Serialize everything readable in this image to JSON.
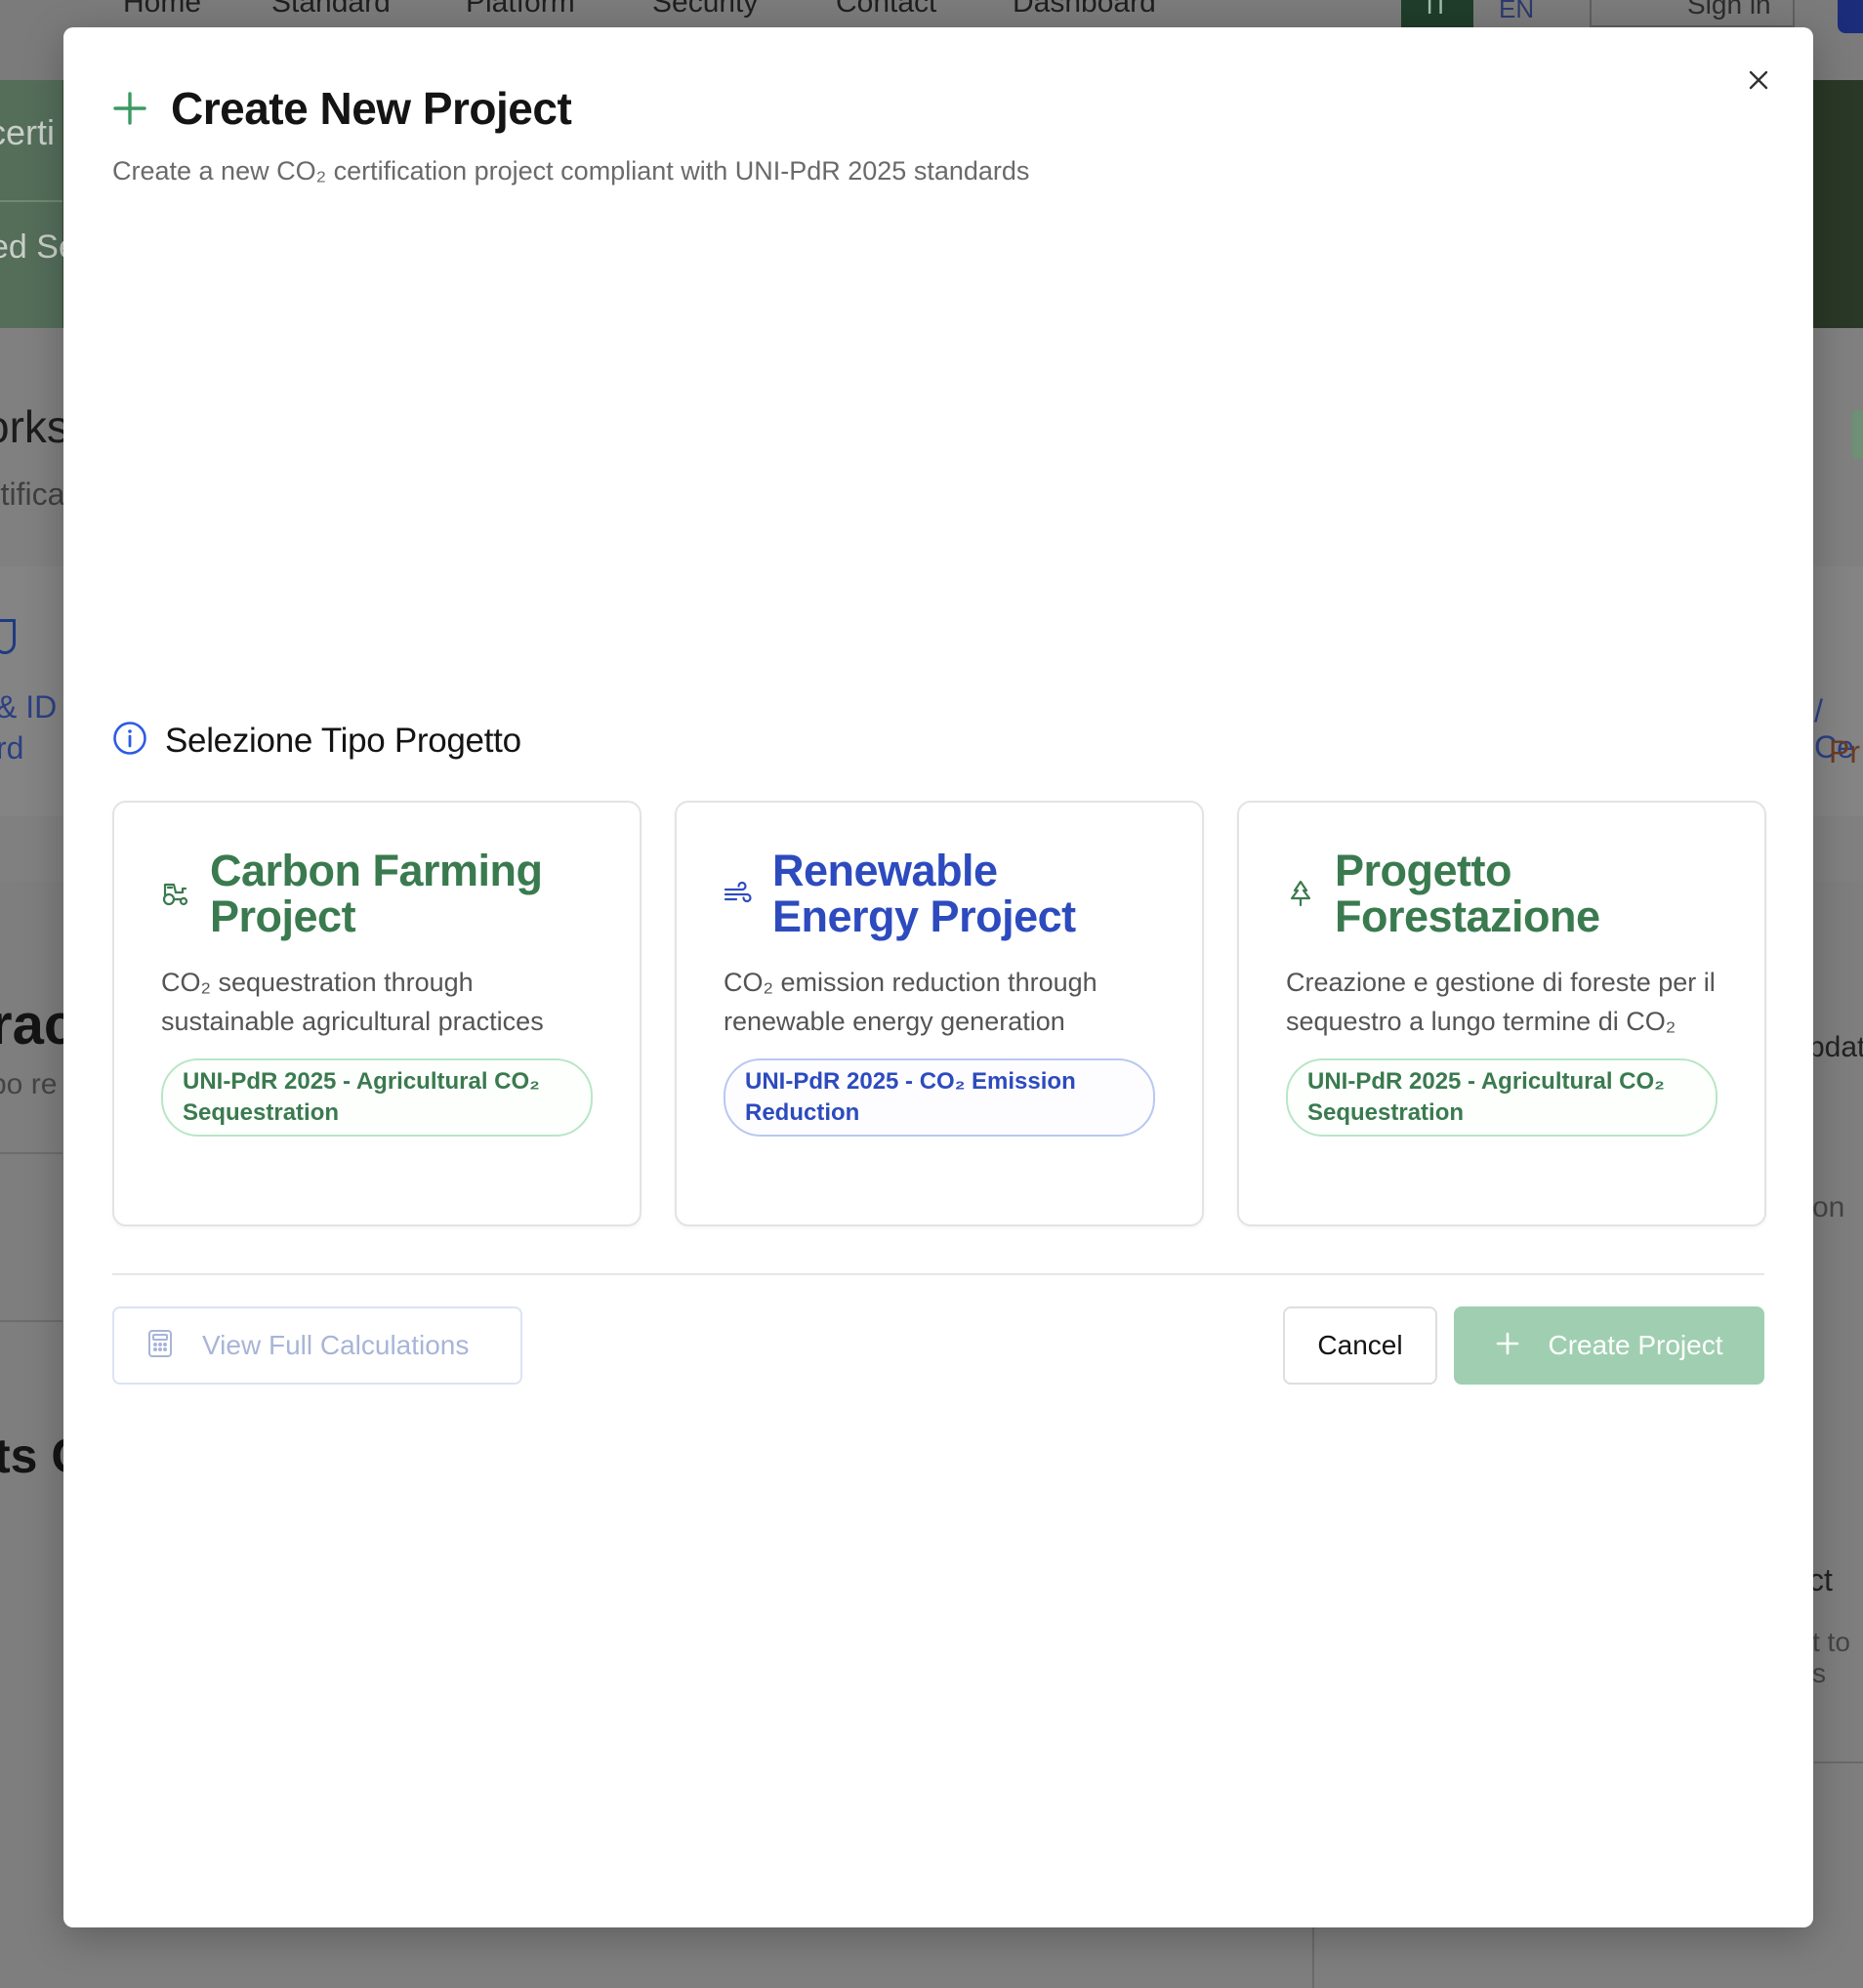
{
  "background": {
    "nav": {
      "items": [
        "Home",
        "Standard",
        "Platform",
        "Security",
        "Contact",
        "Dashboard"
      ],
      "lang_it": "IT",
      "lang_en": "EN",
      "sign_in": "Sign in"
    },
    "fragments": {
      "hero_1": "certi",
      "hero_2": "ed Se",
      "section_title": "orks",
      "section_sub": "rtifica",
      "id_1": "& ID",
      "id_2": "rd",
      "right_1": "/ Ce",
      "right_2": "Pr",
      "lower_title": "rac",
      "lower_sub": "po re",
      "lower_title_2": "ts C",
      "right_update": "pdat",
      "right_on": "on",
      "right_ct": "ct",
      "right_tos": "t to s"
    }
  },
  "modal": {
    "title": "Create New Project",
    "subtitle": "Create a new CO₂ certification project compliant with UNI-PdR 2025 standards",
    "section_title": "Selezione Tipo Progetto",
    "cards": [
      {
        "title": "Carbon Farming Project",
        "description": "CO₂ sequestration through sustainable agricultural practices",
        "badge": "UNI-PdR 2025 - Agricultural CO₂ Sequestration",
        "icon": "tractor-icon",
        "accent": "#3a7a4f"
      },
      {
        "title": "Renewable Energy Project",
        "description": "CO₂ emission reduction through renewable energy generation",
        "badge": "UNI-PdR 2025 - CO₂ Emission Reduction",
        "icon": "wind-icon",
        "accent": "#2d4bbe"
      },
      {
        "title": "Progetto Forestazione",
        "description": "Creazione e gestione di foreste per il sequestro a lungo termine di CO₂",
        "badge": "UNI-PdR 2025 - Agricultural CO₂ Sequestration",
        "icon": "tree-icon",
        "accent": "#3a7a4f"
      }
    ],
    "buttons": {
      "view_calculations": "View Full Calculations",
      "cancel": "Cancel",
      "create": "Create Project"
    }
  }
}
